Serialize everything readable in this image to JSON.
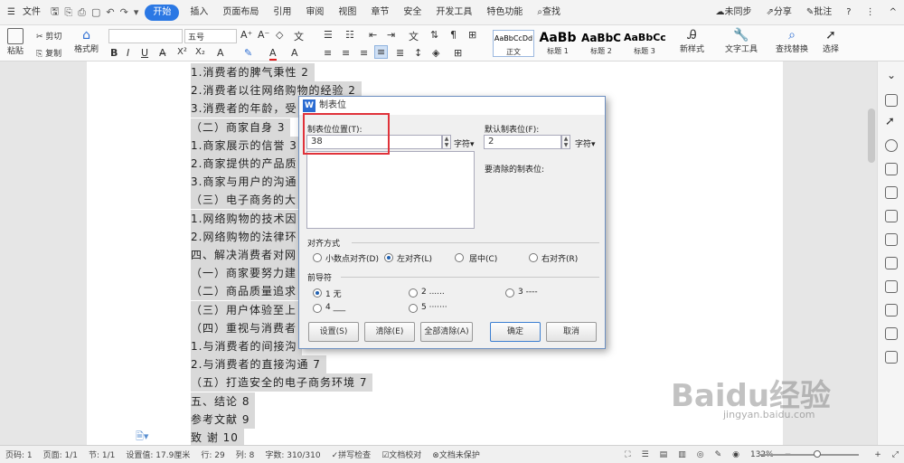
{
  "menubar": {
    "file": "文件",
    "tabs": [
      "开始",
      "插入",
      "页面布局",
      "引用",
      "审阅",
      "视图",
      "章节",
      "安全",
      "开发工具",
      "特色功能"
    ],
    "active": "开始",
    "search": "查找",
    "sync": "未同步",
    "share": "分享",
    "comment": "批注",
    "help": "?"
  },
  "ribbon": {
    "paste": "粘贴",
    "cut": "剪切",
    "copy": "复制",
    "format_painter": "格式刷",
    "font_size": "五号",
    "styles": [
      {
        "preview": "AaBbCcDd",
        "name": "正文"
      },
      {
        "preview": "AaBb",
        "name": "标题 1"
      },
      {
        "preview": "AaBbC",
        "name": "标题 2"
      },
      {
        "preview": "AaBbCc",
        "name": "标题 3"
      }
    ],
    "new_style": "新样式",
    "text_tools": "文字工具",
    "find_replace": "查找替换",
    "select": "选择"
  },
  "document": {
    "lines": [
      "1.消费者的脾气秉性  2",
      "2.消费者以往网络购物的经验  2",
      "3.消费者的年龄，受",
      "（二）商家自身  3",
      "1.商家展示的信誉 3",
      "2.商家提供的产品质",
      "3.商家与用户的沟通",
      "（三）电子商务的大",
      "1.网络购物的技术因",
      "2.网络购物的法律环",
      "四、解决消费者对网",
      "（一）商家要努力建",
      "（二）商品质量追求",
      "（三）用户体验至上",
      "（四）重视与消费者",
      "1.与消费者的间接沟",
      "2.与消费者的直接沟通 7",
      "（五）打造安全的电子商务环境     7",
      "五、结论    8",
      "参考文献    9",
      "致  谢    10"
    ]
  },
  "dialog": {
    "title": "制表位",
    "tab_position_label": "制表位位置(T):",
    "tab_position_value": "38",
    "unit": "字符▾",
    "default_tab_label": "默认制表位(F):",
    "default_tab_value": "2",
    "default_unit": "字符▾",
    "to_clear_label": "要清除的制表位:",
    "alignment_label": "对齐方式",
    "alignments": [
      "小数点对齐(D)",
      "左对齐(L)",
      "居中(C)",
      "右对齐(R)"
    ],
    "alignment_selected": "左对齐(L)",
    "leader_label": "前导符",
    "leaders": [
      "1 无",
      "2 ......",
      "3 ----",
      "4 ___",
      "5 ·······"
    ],
    "leader_selected": "1 无",
    "buttons": {
      "set": "设置(S)",
      "clear": "清除(E)",
      "clear_all": "全部清除(A)",
      "ok": "确定",
      "cancel": "取消"
    }
  },
  "status": {
    "page_num": "页码: 1",
    "pages": "页面: 1/1",
    "section": "节: 1/1",
    "setting": "设置值: 17.9厘米",
    "row": "行: 29",
    "col": "列: 8",
    "words": "字数: 310/310",
    "spell": "拼写检查",
    "proof": "文档校对",
    "protect": "文档未保护",
    "zoom": "132%"
  },
  "watermark": {
    "text": "Baidu经验",
    "url": "jingyan.baidu.com"
  }
}
